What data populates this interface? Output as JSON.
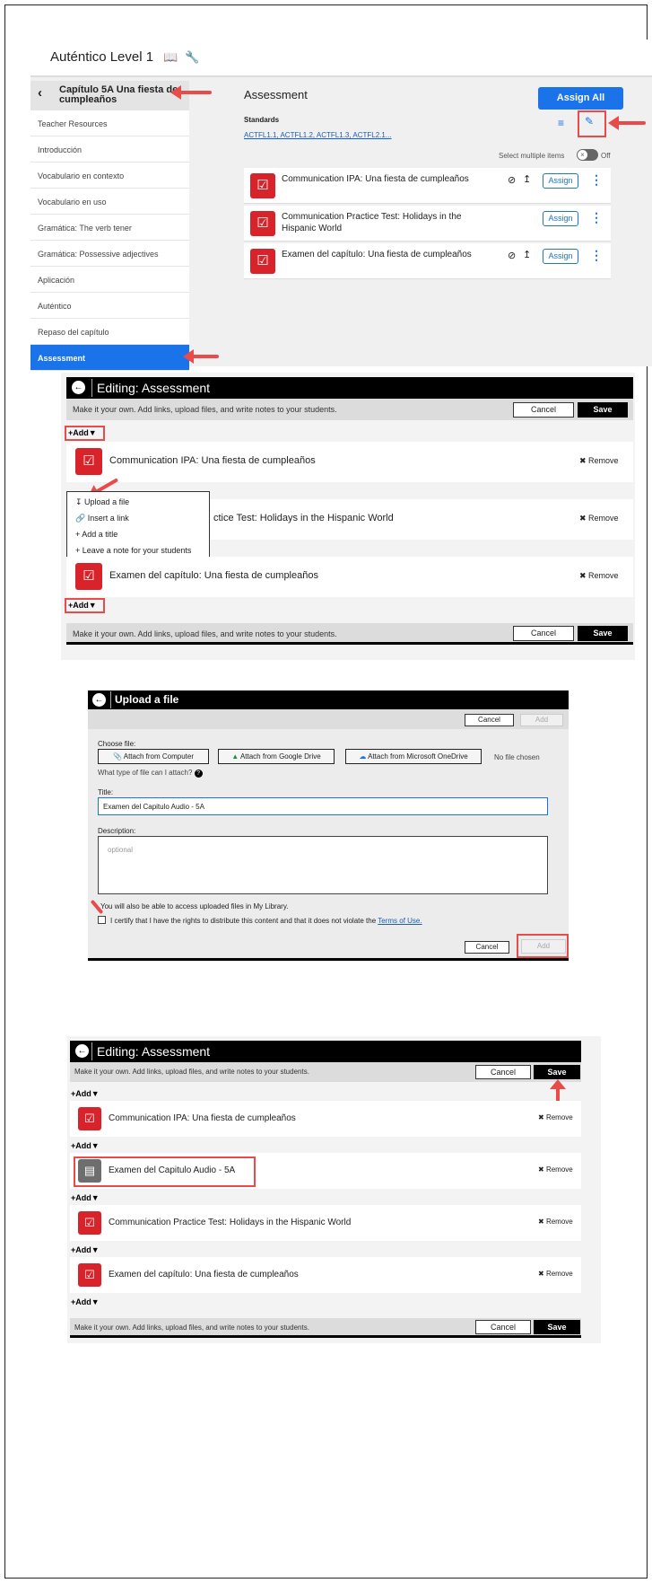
{
  "panel1": {
    "app_title": "Auténtico Level 1",
    "chapter_title": "Capítulo 5A Una fiesta de cumpleaños",
    "sidebar_items": [
      "Teacher Resources",
      "Introducción",
      "Vocabulario en contexto",
      "Vocabulario en uso",
      "Gramática: The verb tener",
      "Gramática: Possessive adjectives",
      "Aplicación",
      "Auténtico",
      "Repaso del capítulo",
      "Assessment"
    ],
    "section_title": "Assessment",
    "assign_all": "Assign All",
    "standards_label": "Standards",
    "standards_links": "ACTFL1.1, ACTFL1.2, ACTFL1.3, ACTFL2.1...",
    "select_multiple": "Select multiple items",
    "toggle_state": "Off",
    "items": [
      "Communication IPA: Una fiesta de cumpleaños",
      "Communication Practice Test: Holidays in the Hispanic World",
      "Examen del capítulo: Una fiesta de cumpleaños"
    ],
    "assign_label": "Assign"
  },
  "panel2": {
    "title": "Editing: Assessment",
    "instructions": "Make it your own. Add links, upload files, and write notes to your students.",
    "cancel": "Cancel",
    "save": "Save",
    "add": "Add",
    "remove": "Remove",
    "items": [
      "Communication IPA: Una fiesta de cumpleaños",
      "ctice Test: Holidays in the Hispanic World",
      "Examen del capítulo: Una fiesta de cumpleaños"
    ],
    "menu": [
      "Upload a file",
      "Insert a link",
      "Add a title",
      "Leave a note for your students"
    ]
  },
  "panel3": {
    "title": "Upload a file",
    "cancel": "Cancel",
    "add": "Add",
    "choose_file": "Choose file:",
    "attach_computer": "Attach from Computer",
    "attach_drive": "Attach from Google Drive",
    "attach_onedrive": "Attach from Microsoft OneDrive",
    "no_file": "No file chosen",
    "file_types": "What type of file can I attach?",
    "title_label": "Title:",
    "title_value": "Examen del Capitulo Audio - 5A",
    "description_label": "Description:",
    "description_placeholder": "optional",
    "library_note": "You will also be able to access uploaded files in My Library.",
    "certify": "I certify that I have the rights to distribute this content and that it does not violate the",
    "terms": "Terms of Use."
  },
  "panel4": {
    "title": "Editing: Assessment",
    "instructions": "Make it your own. Add links, upload files, and write notes to your students.",
    "cancel": "Cancel",
    "save": "Save",
    "add": "Add",
    "remove": "Remove",
    "items": [
      "Communication IPA: Una fiesta de cumpleaños",
      "Examen del Capitulo Audio - 5A",
      "Communication Practice Test: Holidays in the Hispanic World",
      "Examen del capítulo: Una fiesta de cumpleaños"
    ]
  },
  "colors": {
    "accent": "#1a73e8",
    "red": "#d8232a",
    "annotation": "#e94b4b"
  }
}
